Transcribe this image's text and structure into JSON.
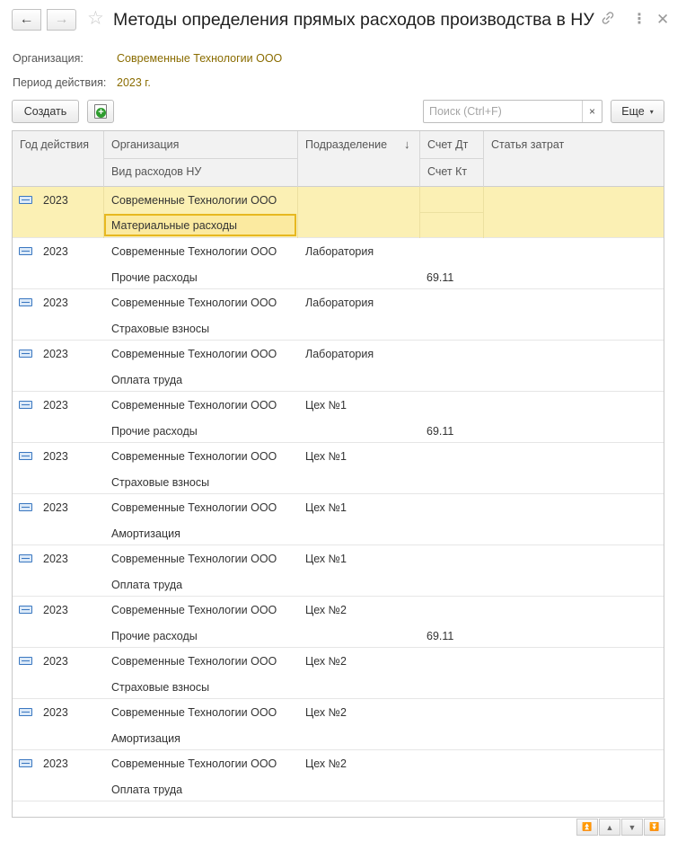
{
  "window": {
    "title": "Методы определения прямых расходов производства в НУ",
    "back_icon": "←",
    "forward_icon": "→",
    "star_icon": "☆",
    "link_icon": "🔗",
    "more_icon": "⋮",
    "close_icon": "✕"
  },
  "filters": {
    "organization_label": "Организация:",
    "organization_value": "Современные Технологии ООО",
    "period_label": "Период действия:",
    "period_value": "2023 г."
  },
  "toolbar": {
    "create_label": "Создать",
    "search_placeholder": "Поиск (Ctrl+F)",
    "search_clear": "×",
    "more_label": "Еще",
    "more_caret": "▾"
  },
  "table": {
    "columns": {
      "year": "Год действия",
      "organization": "Организация",
      "expense_type": "Вид расходов НУ",
      "division": "Подразделение",
      "sort_indicator": "↓",
      "debit": "Счет Дт",
      "credit": "Счет Кт",
      "cost_item": "Статья затрат"
    },
    "rows": [
      {
        "year": "2023",
        "organization": "Современные Технологии ООО",
        "division": "",
        "expense_type": "Материальные расходы",
        "account": ""
      },
      {
        "year": "2023",
        "organization": "Современные Технологии ООО",
        "division": "Лаборатория",
        "expense_type": "Прочие расходы",
        "account": "69.11"
      },
      {
        "year": "2023",
        "organization": "Современные Технологии ООО",
        "division": "Лаборатория",
        "expense_type": "Страховые взносы",
        "account": ""
      },
      {
        "year": "2023",
        "organization": "Современные Технологии ООО",
        "division": "Лаборатория",
        "expense_type": "Оплата труда",
        "account": ""
      },
      {
        "year": "2023",
        "organization": "Современные Технологии ООО",
        "division": "Цех №1",
        "expense_type": "Прочие расходы",
        "account": "69.11"
      },
      {
        "year": "2023",
        "organization": "Современные Технологии ООО",
        "division": "Цех №1",
        "expense_type": "Страховые взносы",
        "account": ""
      },
      {
        "year": "2023",
        "organization": "Современные Технологии ООО",
        "division": "Цех №1",
        "expense_type": "Амортизация",
        "account": ""
      },
      {
        "year": "2023",
        "organization": "Современные Технологии ООО",
        "division": "Цех №1",
        "expense_type": "Оплата труда",
        "account": ""
      },
      {
        "year": "2023",
        "organization": "Современные Технологии ООО",
        "division": "Цех №2",
        "expense_type": "Прочие расходы",
        "account": "69.11"
      },
      {
        "year": "2023",
        "organization": "Современные Технологии ООО",
        "division": "Цех №2",
        "expense_type": "Страховые взносы",
        "account": ""
      },
      {
        "year": "2023",
        "organization": "Современные Технологии ООО",
        "division": "Цех №2",
        "expense_type": "Амортизация",
        "account": ""
      },
      {
        "year": "2023",
        "organization": "Современные Технологии ООО",
        "division": "Цех №2",
        "expense_type": "Оплата труда",
        "account": ""
      }
    ]
  },
  "scroll": {
    "first": "⏫",
    "up": "▲",
    "down": "▼",
    "last": "⏬"
  },
  "colors": {
    "accent_value": "#8a6c00",
    "selected_row": "#fbf0b4",
    "selected_cell_border": "#e7b820"
  }
}
